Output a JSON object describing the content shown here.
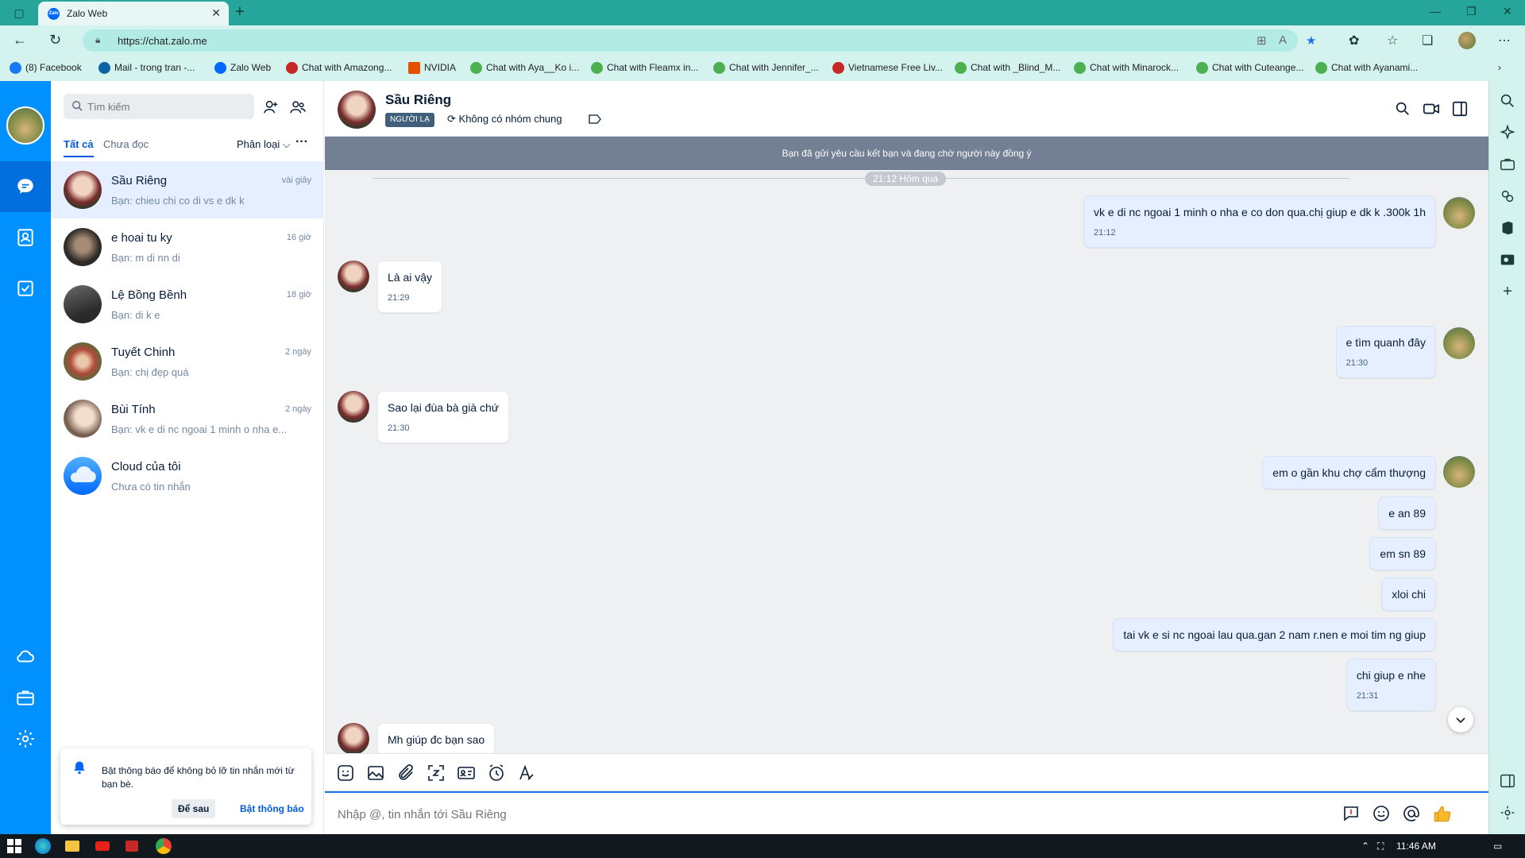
{
  "browser": {
    "tab_title": "Zalo Web",
    "url": "https://chat.zalo.me",
    "bookmarks": [
      {
        "label": "(8) Facebook",
        "color": "#1877f2"
      },
      {
        "label": "Mail - trong tran -...",
        "color": "#0a64a4"
      },
      {
        "label": "Zalo Web",
        "color": "#0068ff"
      },
      {
        "label": "Chat with Amazong...",
        "color": "#c62828"
      },
      {
        "label": "NVIDIA",
        "color": "#e65100"
      },
      {
        "label": "Chat with Aya__Ko i...",
        "color": "#4caf50"
      },
      {
        "label": "Chat with Fleamx in...",
        "color": "#4caf50"
      },
      {
        "label": "Chat with Jennifer_...",
        "color": "#4caf50"
      },
      {
        "label": "Vietnamese Free Liv...",
        "color": "#c62828"
      },
      {
        "label": "Chat with _Blind_M...",
        "color": "#4caf50"
      },
      {
        "label": "Chat with Minarock...",
        "color": "#4caf50"
      },
      {
        "label": "Chat with Cuteange...",
        "color": "#4caf50"
      },
      {
        "label": "Chat with Ayanami...",
        "color": "#4caf50"
      }
    ]
  },
  "sidebar": {
    "search_placeholder": "Tìm kiếm",
    "tabs": {
      "all": "Tất cả",
      "unread": "Chưa đọc"
    },
    "classify": "Phân loại",
    "more": "···",
    "conversations": [
      {
        "name": "Sầu Riêng",
        "preview": "Bạn: chieu chi co di vs e dk k",
        "time": "vài giây",
        "active": true
      },
      {
        "name": "e hoai tu ky",
        "preview": "Bạn: m di nn di",
        "time": "16 giờ"
      },
      {
        "name": "Lệ Bồng Bềnh",
        "preview": "Bạn: di k e",
        "time": "18 giờ"
      },
      {
        "name": "Tuyết Chinh",
        "preview": "Bạn: chị đẹp quá",
        "time": "2 ngày"
      },
      {
        "name": "Bùi Tính",
        "preview": "Bạn: vk e di nc ngoai 1 minh o nha e...",
        "time": "2 ngày"
      },
      {
        "name": "Cloud của tôi",
        "preview": "Chưa có tin nhắn",
        "time": ""
      }
    ],
    "notification": {
      "text": "Bật thông báo để không bỏ lỡ tin nhắn mới từ bạn bè.",
      "later": "Để sau",
      "enable": "Bật thông báo"
    }
  },
  "chat": {
    "contact_name": "Sầu Riêng",
    "stranger_badge": "NGƯỜI LẠ",
    "common_groups": "Không có nhóm chung",
    "banner": "Bạn đã gửi yêu cầu kết bạn và đang chờ người này đồng ý",
    "divider": "21:12 Hôm qua",
    "messages": [
      {
        "from": "me",
        "text": "vk e di nc ngoai 1 minh o nha e co don qua.chị giup e dk k .300k 1h",
        "time": "21:12"
      },
      {
        "from": "them",
        "text": "Là ai vậy",
        "time": "21:29"
      },
      {
        "from": "me",
        "text": "e tìm quanh đây",
        "time": "21:30"
      },
      {
        "from": "them",
        "text": "Sao lại đùa bà già chứ",
        "time": "21:30"
      },
      {
        "from": "me",
        "text": "em o gần khu chợ cẩm thượng",
        "time": ""
      },
      {
        "from": "me",
        "text": "e an 89",
        "time": ""
      },
      {
        "from": "me",
        "text": "em sn 89",
        "time": ""
      },
      {
        "from": "me",
        "text": "xloi chi",
        "time": ""
      },
      {
        "from": "me",
        "text": "tai vk e si nc ngoai lau qua.gan 2 nam r.nen e moi tim ng giup",
        "time": ""
      },
      {
        "from": "me",
        "text": "chi giup e nhe",
        "time": "21:31"
      },
      {
        "from": "them",
        "text": "Mh giúp đc bạn sao",
        "time": ""
      }
    ],
    "composer_placeholder": "Nhập @, tin nhắn tới Sầu Riêng"
  },
  "taskbar": {
    "time": "11:46 AM"
  },
  "colors": {
    "zalo_blue": "#0091ff",
    "browser_teal": "#26a69a",
    "my_bubble": "#e5efff"
  }
}
